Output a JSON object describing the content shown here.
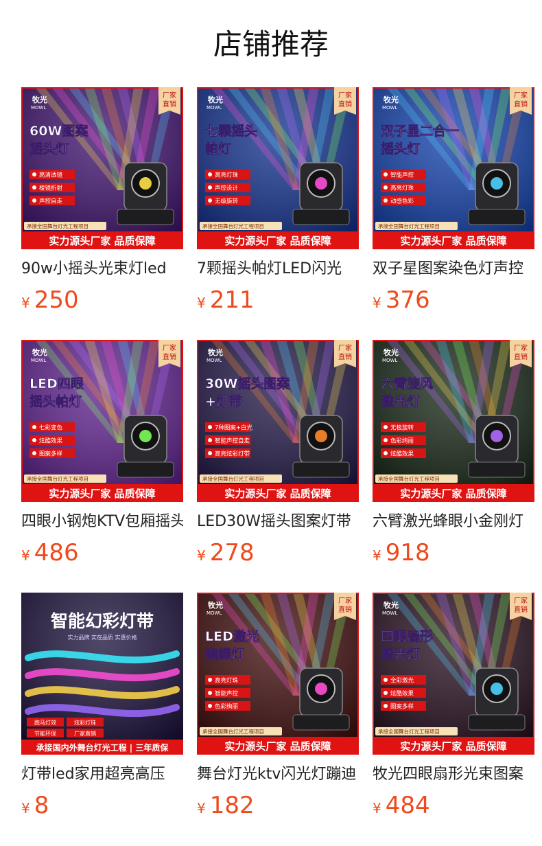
{
  "section_title": "店铺推荐",
  "colors": {
    "price": "#ee4a1c",
    "banner_red": "#e01313"
  },
  "common": {
    "brand": "牧光",
    "brand_sub": "MOWL",
    "badge_line1": "厂家",
    "badge_line2": "直销",
    "strip_text": "承接全国舞台灯光工程项目",
    "banner_text": "实力源头厂家 品质保障"
  },
  "products": [
    {
      "headline1": "60W图案",
      "headline2": "摇头灯",
      "tags": [
        "高清透镜",
        "棱镜折射",
        "声控自走"
      ],
      "name": "90w小摇头光束灯led",
      "currency": "¥",
      "price": "250",
      "theme": "beam",
      "bg": "#3a0a6a"
    },
    {
      "headline1": "七颗摇头",
      "headline2": "帕灯",
      "tags": [
        "高亮灯珠",
        "声控设计",
        "无级旋转"
      ],
      "name": "7颗摇头帕灯LED闪光",
      "currency": "¥",
      "price": "211",
      "theme": "moving",
      "bg": "#0a2a8a"
    },
    {
      "headline1": "双子星二合一",
      "headline2": "摇头灯",
      "tags": [
        "智能声控",
        "高亮灯珠",
        "动感色彩"
      ],
      "name": "双子星图案染色灯声控",
      "currency": "¥",
      "price": "376",
      "theme": "twin",
      "bg": "#0b3aa8"
    },
    {
      "headline1": "LED四眼",
      "headline2": "摇头帕灯",
      "tags": [
        "七彩变色",
        "炫酷效果",
        "图案多样"
      ],
      "name": "四眼小钢炮KTV包厢摇头",
      "currency": "¥",
      "price": "486",
      "theme": "foureye",
      "bg": "#5a1a8a"
    },
    {
      "headline1": "30W摇头图案",
      "headline2": "+灯带",
      "tags": [
        "7种图案+白光",
        "智能声控自走",
        "高亮炫彩灯带"
      ],
      "name": "LED30W摇头图案灯带",
      "currency": "¥",
      "price": "278",
      "theme": "pattern",
      "bg": "#1a1040"
    },
    {
      "headline1": "六臂旋风",
      "headline2": "激光灯",
      "tags": [
        "无极旋转",
        "色彩绚丽",
        "炫酷效果"
      ],
      "name": "六臂激光蜂眼小金刚灯",
      "currency": "¥",
      "price": "918",
      "theme": "sixarm",
      "bg": "#102010"
    },
    {
      "headline1": "智能幻彩灯带",
      "headline2": "",
      "tags": [
        "跑马灯效",
        "炫彩灯珠",
        "节能环保",
        "厂家直销"
      ],
      "name": "灯带led家用超亮高压",
      "currency": "¥",
      "price": "8",
      "theme": "strip",
      "bg": "#150a35",
      "slogan": "实力品牌 实在品质 实惠价格",
      "bottom": "承接国内外舞台灯光工程 | 三年质保"
    },
    {
      "headline1": "LED激光",
      "headline2": "蝴蝶灯",
      "tags": [
        "高亮灯珠",
        "智能声控",
        "色彩绚丽"
      ],
      "name": "舞台灯光ktv闪光灯蹦迪",
      "currency": "¥",
      "price": "182",
      "theme": "butterfly",
      "bg": "#3a0505"
    },
    {
      "headline1": "四眼扇形",
      "headline2": "激光灯",
      "tags": [
        "全彩激光",
        "炫酷效果",
        "图案多样"
      ],
      "name": "牧光四眼扇形光束图案",
      "currency": "¥",
      "price": "484",
      "theme": "fan",
      "bg": "#200818"
    }
  ]
}
